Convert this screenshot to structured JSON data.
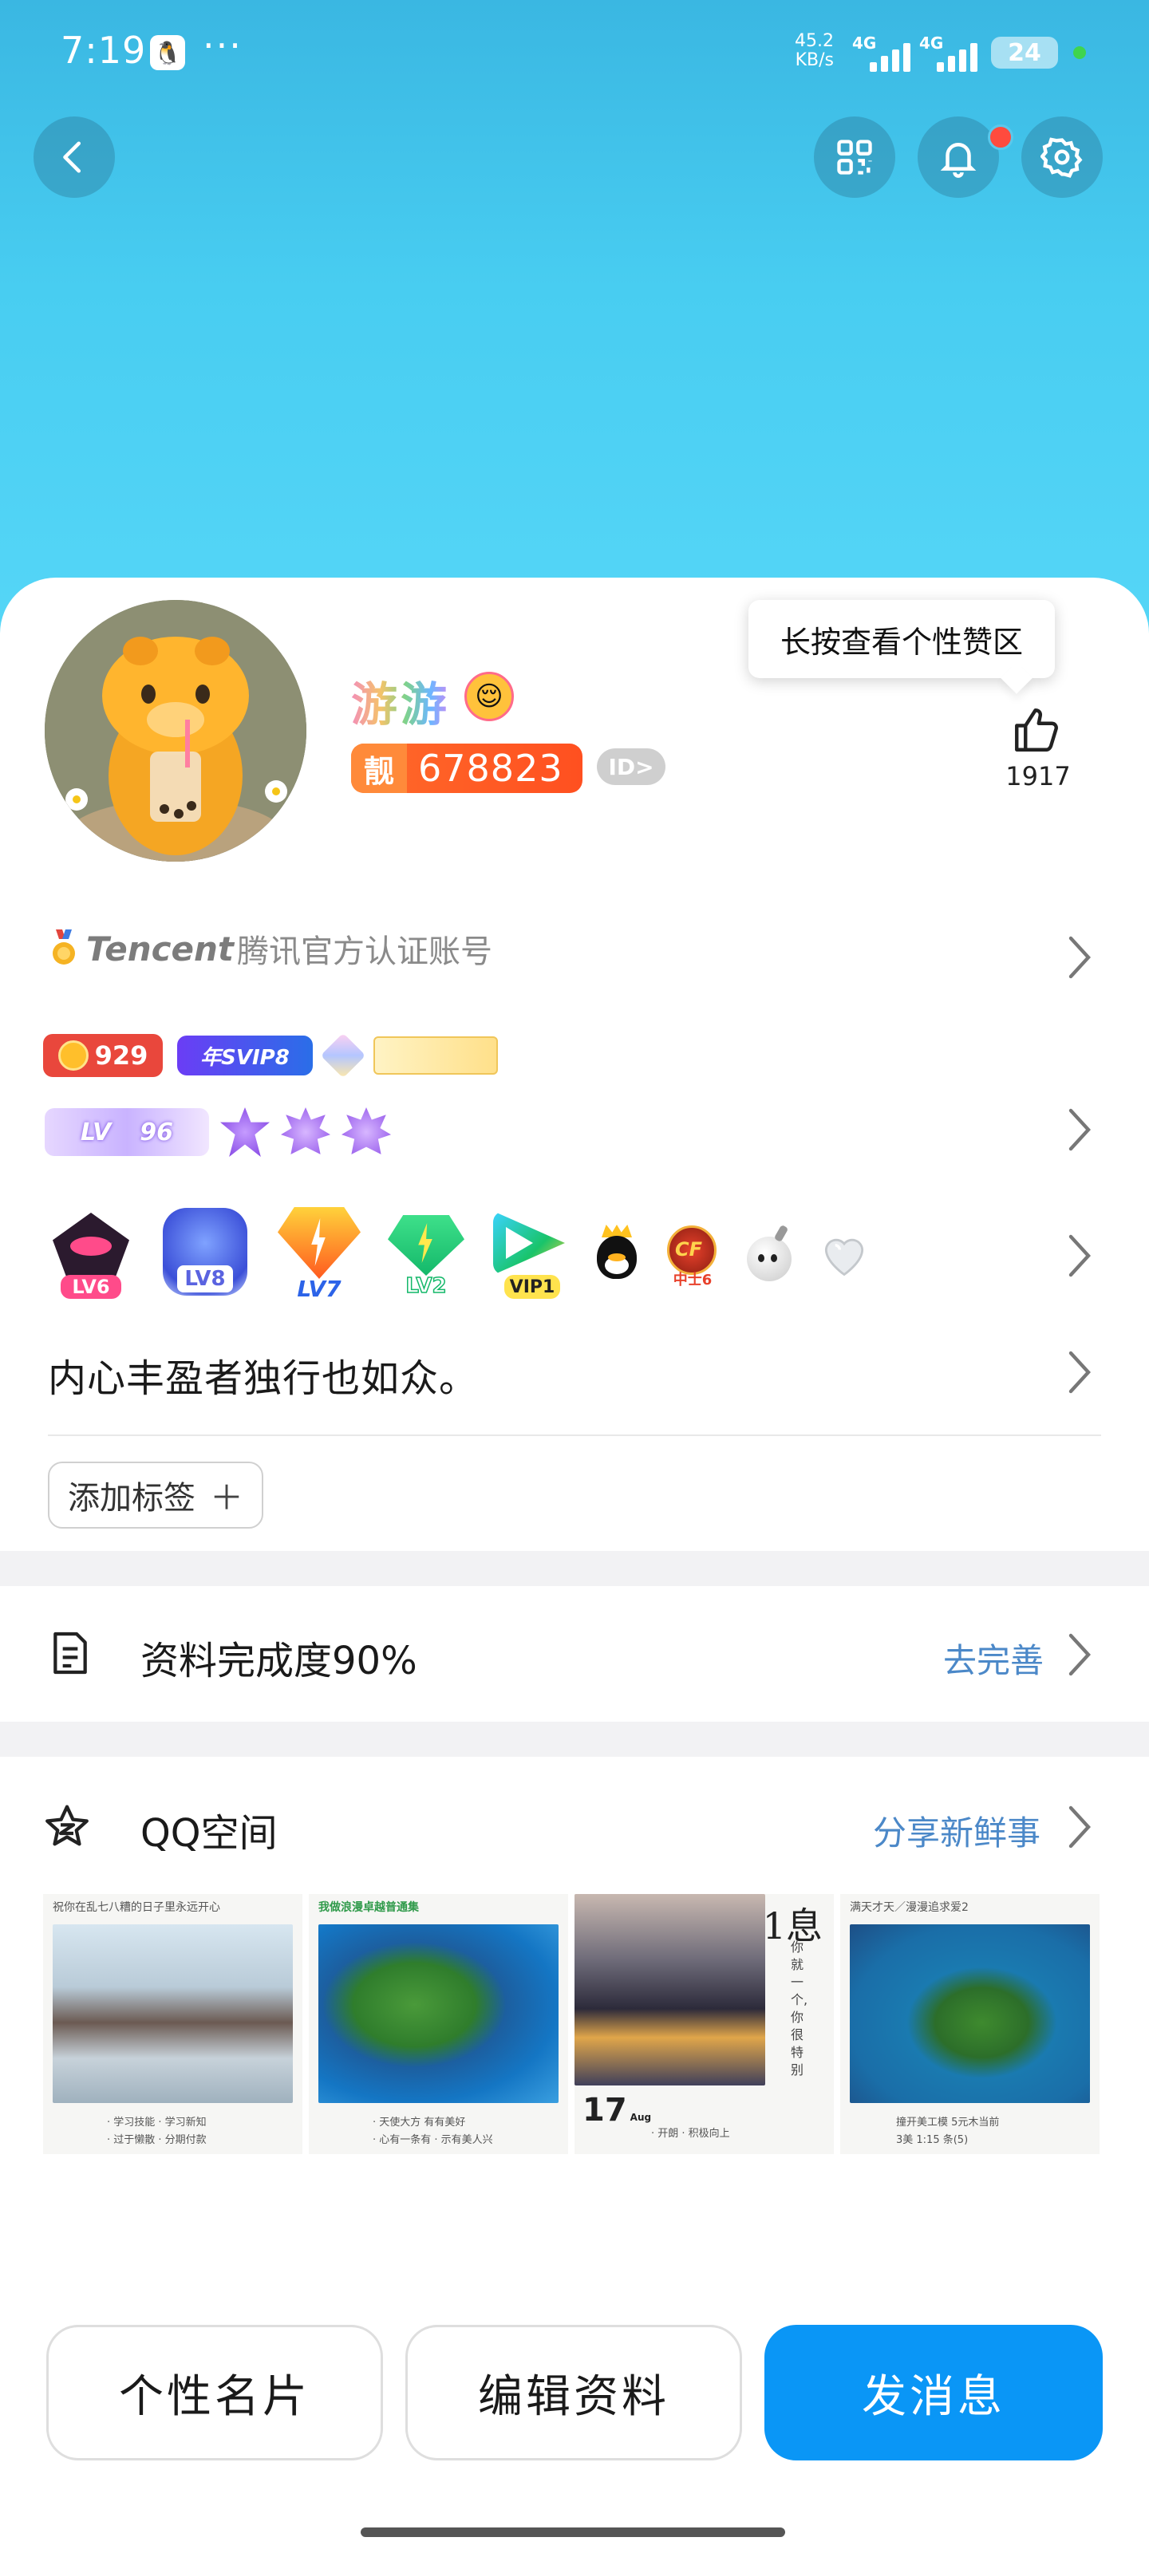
{
  "status_bar": {
    "time": "7:19",
    "dots": "···",
    "speed_value": "45.2",
    "speed_unit": "KB/s",
    "sim1": "4G",
    "sim2": "4G",
    "battery": "24"
  },
  "header": {
    "back_icon": "chevron-left-icon",
    "qr_icon": "qr-code-icon",
    "bell_icon": "bell-icon",
    "settings_icon": "gear-icon",
    "has_notification": true
  },
  "profile": {
    "nickname": "游游",
    "number_prefix": "靓",
    "number": "678823",
    "id_label": "ID>",
    "likes": "1917",
    "tooltip": "长按查看个性赞区"
  },
  "certification": {
    "brand": "Tencent",
    "text": "腾讯官方认证账号"
  },
  "badges": {
    "coin": "929",
    "svip": "年SVIP8",
    "lv_prefix": "LV",
    "lv_value": "96",
    "game_levels": [
      "LV6",
      "LV8",
      "LV7",
      "LV2",
      "VIP1",
      "中士6"
    ]
  },
  "signature": "内心丰盈者独行也如众。",
  "tags": {
    "add_label": "添加标签",
    "plus": "＋"
  },
  "completeness": {
    "title": "资料完成度90%",
    "action": "去完善"
  },
  "qzone": {
    "title": "QQ空间",
    "action": "分享新鲜事",
    "thumbs": [
      {
        "caption": "祝你在乱七八糟的日子里永远开心",
        "lines": [
          "· 学习技能 · 学习新知",
          "· 过于懒散 · 分期付款"
        ]
      },
      {
        "caption": "我做浪漫卓越普通集",
        "lines": [
          "· 天使大方    有有美好",
          "· 心有一条有 ·  示有美人兴"
        ]
      },
      {
        "date": "17",
        "date_month": "Aug",
        "calligraphy": "1息",
        "vertical": "你就一个,你很特别",
        "lines": [
          "· 开朗    · 积极向上"
        ]
      },
      {
        "caption": "满天才天／漫漫追求爱2",
        "lines": [
          "撞开美工模    5元木当前",
          "3美 1:15 条(5)"
        ]
      }
    ]
  },
  "buttons": {
    "card": "个性名片",
    "edit": "编辑资料",
    "message": "发消息"
  },
  "colors": {
    "header_gradient_top": "#3ab7e2",
    "header_gradient_bottom": "#55d6f7",
    "primary": "#0a96f6",
    "link": "#4b88c8",
    "number_badge": "#ff5a24",
    "notification": "#ff4b3e"
  }
}
